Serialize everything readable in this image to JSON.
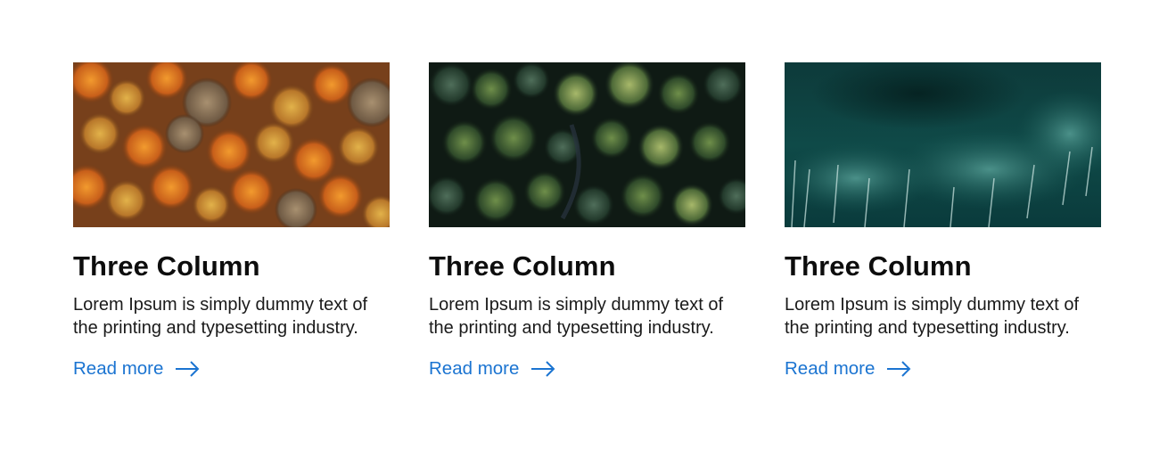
{
  "cards": [
    {
      "title": "Three Column",
      "description": "Lorem Ipsum is simply dummy text of the printing and typesetting industry.",
      "link_label": "Read more",
      "image": "autumn-forest-aerial",
      "link_icon": "arrow-right-icon"
    },
    {
      "title": "Three Column",
      "description": "Lorem Ipsum is simply dummy text of the printing and typesetting industry.",
      "link_label": "Read more",
      "image": "green-forest-aerial",
      "link_icon": "arrow-right-icon"
    },
    {
      "title": "Three Column",
      "description": "Lorem Ipsum is simply dummy text of the printing and typesetting industry.",
      "link_label": "Read more",
      "image": "ocean-waves-aerial",
      "link_icon": "arrow-right-icon"
    }
  ],
  "colors": {
    "link": "#1b74d1",
    "heading": "#0d0d0d",
    "body_text": "#1a1a1a",
    "background": "#ffffff"
  }
}
